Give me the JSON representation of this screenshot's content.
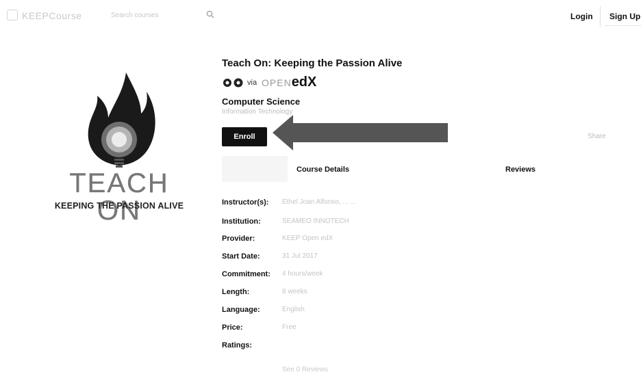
{
  "header": {
    "logo_text": "KEEPCourse",
    "search_placeholder": "Search courses",
    "login_label": "Login",
    "signup_label": "Sign Up"
  },
  "course_logo": {
    "title": "TEACH ON",
    "subtitle": "KEEPING THE PASSION ALIVE"
  },
  "course": {
    "title": "Teach On: Keeping the Passion Alive",
    "via_label": "via",
    "provider_logo_open": "OPEN",
    "provider_logo_edx": "edX",
    "subject": "Computer Science",
    "subject_sub": "Information Technology",
    "enroll_label": "Enroll",
    "share_text": "Share"
  },
  "tabs": {
    "details_label": "Course Details",
    "reviews_label": "Reviews"
  },
  "details": [
    {
      "key": "Instructor(s):",
      "value": "Ethel Joan Alfonso, ... ... "
    },
    {
      "key": "Institution:",
      "value": "SEAMEO INNOTECH"
    },
    {
      "key": "Provider:",
      "value": "KEEP Open edX"
    },
    {
      "key": "Start Date:",
      "value": "31 Jul 2017"
    },
    {
      "key": "Commitment:",
      "value": "4 hours/week"
    },
    {
      "key": "Length:",
      "value": "8 weeks"
    },
    {
      "key": "Language:",
      "value": "English"
    },
    {
      "key": "Price:",
      "value": "Free"
    },
    {
      "key": "Ratings:",
      "value": ""
    }
  ],
  "ratings_link": "See 0 Reviews",
  "colors": {
    "enroll_bg": "#111111",
    "arrow": "#555555",
    "flame": "#1a1a1a"
  }
}
